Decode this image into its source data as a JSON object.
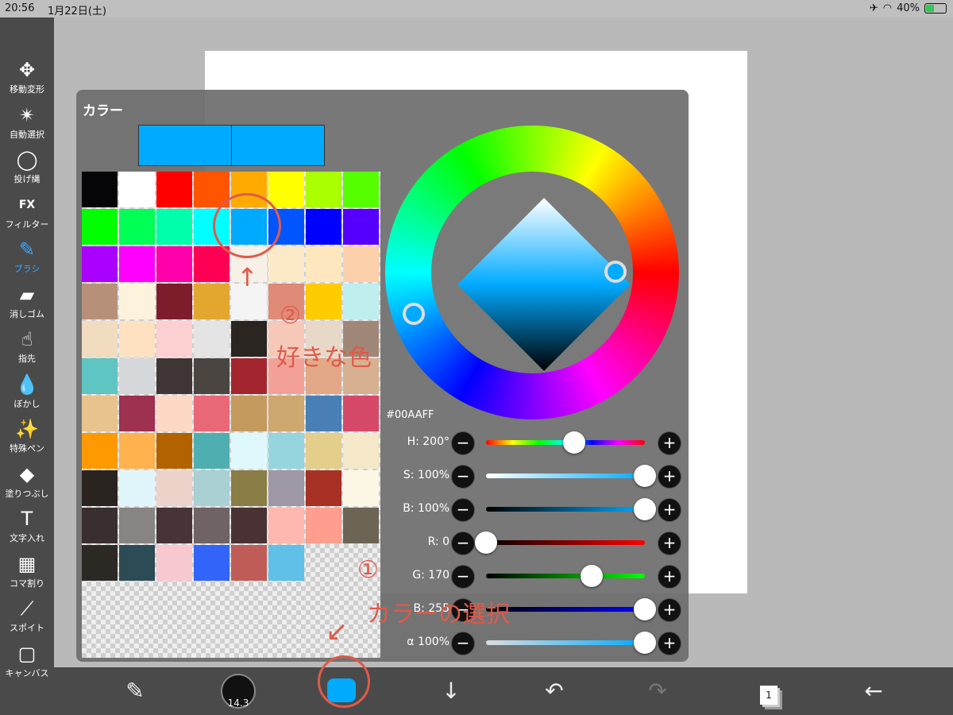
{
  "status": {
    "time": "20:56",
    "date": "1月22日(土)",
    "battery": "40%"
  },
  "tools": [
    {
      "label": "移動変形",
      "icon": "move-icon",
      "glyph": "✥"
    },
    {
      "label": "自動選択",
      "icon": "magic-wand-icon",
      "glyph": "✴"
    },
    {
      "label": "投げ縄",
      "icon": "lasso-icon",
      "glyph": "◯"
    },
    {
      "label": "フィルター",
      "icon": "fx-icon",
      "glyph": "FX"
    },
    {
      "label": "ブラシ",
      "icon": "brush-icon",
      "glyph": "✎"
    },
    {
      "label": "消しゴム",
      "icon": "eraser-icon",
      "glyph": "▰"
    },
    {
      "label": "指先",
      "icon": "finger-icon",
      "glyph": "☝"
    },
    {
      "label": "ぼかし",
      "icon": "blur-icon",
      "glyph": "💧"
    },
    {
      "label": "特殊ペン",
      "icon": "special-pen-icon",
      "glyph": "✨"
    },
    {
      "label": "塗りつぶし",
      "icon": "bucket-icon",
      "glyph": "◆"
    },
    {
      "label": "文字入れ",
      "icon": "text-icon",
      "glyph": "T"
    },
    {
      "label": "コマ割り",
      "icon": "frame-icon",
      "glyph": "▦"
    },
    {
      "label": "スポイト",
      "icon": "eyedropper-icon",
      "glyph": "⟋"
    },
    {
      "label": "キャンバス",
      "icon": "canvas-icon",
      "glyph": "▢"
    }
  ],
  "active_tool": "ブラシ",
  "panel": {
    "title": "カラー",
    "hex": "#00AAFF",
    "current_color": "#00AAFF",
    "previous_color": "#00AAFF"
  },
  "palette": [
    [
      "#050508",
      "#ffffff",
      "#ff0000",
      "#ff5500",
      "#ffaa00",
      "#ffff00",
      "#aaff00",
      "#55ff00"
    ],
    [
      "#00ff00",
      "#00ff55",
      "#00ffaa",
      "#00ffff",
      "#00aaff",
      "#0055ff",
      "#0000ff",
      "#5500ff"
    ],
    [
      "#aa00ff",
      "#ff00ff",
      "#ff00aa",
      "#ff0055",
      "#f6f0e6",
      "#fbe9c7",
      "#fde7bf",
      "#fcd0ab"
    ],
    [
      "#b7907a",
      "#fdf2dc",
      "#7d1c2a",
      "#e3a72f",
      "#f4f4f4",
      "#e08a78",
      "#ffcc00",
      "#bfeeee"
    ],
    [
      "#f1dcc0",
      "#fde1c0",
      "#fcd0d0",
      "#e4e4e4",
      "#2a2520",
      "#f6c8b8",
      "#e8d8c8",
      "#a08878"
    ],
    [
      "#5fc5c2",
      "#d4d8da",
      "#3f3535",
      "#4a4540",
      "#a3262e",
      "#f3a198",
      "#e2a888",
      "#d6b090"
    ],
    [
      "#e8c38e",
      "#9e3050",
      "#fdd9c4",
      "#e86878",
      "#c49a5e",
      "#cfa86f",
      "#4a7fb5",
      "#d74968"
    ],
    [
      "#ff9900",
      "#ffb24d",
      "#b36200",
      "#4fafb0",
      "#dff8fb",
      "#96d5dd",
      "#e3cf8b",
      "#f4e8c8"
    ],
    [
      "#2a2420",
      "#e0f6fa",
      "#eed3cb",
      "#a9d0d2",
      "#8a7d45",
      "#9e97a4",
      "#a63124",
      "#fdf7e6"
    ],
    [
      "#392f30",
      "#888484",
      "#483437",
      "#6f6363",
      "#4a3234",
      "#ffb8b0",
      "#ff9e8e",
      "#6c6454"
    ],
    [
      "#2c2924",
      "#2c4c55",
      "#f8c8d0",
      "#3264fa",
      "#c05c58",
      "#60c0e8"
    ]
  ],
  "sliders": [
    {
      "label": "H:",
      "value": "200°",
      "pos": 0.556,
      "track": "linear-gradient(90deg,#f00,#ff0,#0f0,#0ff,#00f,#f0f,#f00)"
    },
    {
      "label": "S:",
      "value": "100%",
      "pos": 1.0,
      "track": "linear-gradient(90deg,#fff,#00aaff)"
    },
    {
      "label": "B:",
      "value": "100%",
      "pos": 1.0,
      "track": "linear-gradient(90deg,#000,#00aaff)"
    },
    {
      "label": "R:",
      "value": "0",
      "pos": 0.0,
      "track": "linear-gradient(90deg,#000,#ff0000)"
    },
    {
      "label": "G:",
      "value": "170",
      "pos": 0.667,
      "track": "linear-gradient(90deg,#000,#00ff00)"
    },
    {
      "label": "B:",
      "value": "255",
      "pos": 1.0,
      "track": "linear-gradient(90deg,#000,#0000ff)"
    },
    {
      "label": "α",
      "value": "100%",
      "pos": 1.0,
      "track": "linear-gradient(90deg,#ddd,#00aaff)"
    }
  ],
  "bottombar": {
    "brush_size": "14.3"
  },
  "annotations": {
    "one": "①",
    "one_text": "カラーの選択",
    "two": "②",
    "two_text": "好きな色"
  }
}
